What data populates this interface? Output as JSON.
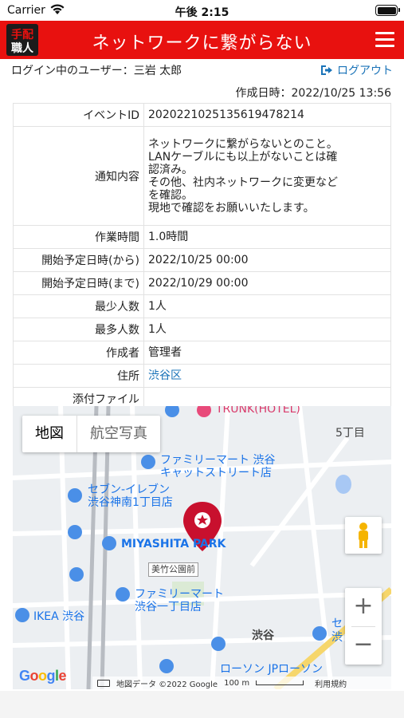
{
  "status_bar": {
    "carrier": "Carrier",
    "time": "午後 2:15"
  },
  "header": {
    "title": "ネットワークに繋がらない",
    "logo": "手配職人"
  },
  "user": {
    "label": "ログイン中のユーザー：三岩 太郎",
    "logout": "ログアウト"
  },
  "created": "作成日時：2022/10/25 13:56",
  "details": {
    "event_id": {
      "label": "イベントID",
      "value": "202022102513561947821 4"
    },
    "notice": {
      "label": "通知内容",
      "lines": [
        "ネットワークに繋がらないとのこと。",
        "LANケーブルにも以上がないことは確",
        "認済み。",
        "その他、社内ネットワークに変更など",
        "を確認。",
        "現地で確認をお願いいたします。"
      ]
    },
    "work_time": {
      "label": "作業時間",
      "value": "1.0時間"
    },
    "start_from": {
      "label": "開始予定日時(から)",
      "value": "2022/10/25 00:00"
    },
    "start_to": {
      "label": "開始予定日時(まで)",
      "value": "2022/10/29 00:00"
    },
    "min_people": {
      "label": "最少人数",
      "value": "1人"
    },
    "max_people": {
      "label": "最多人数",
      "value": "1人"
    },
    "author": {
      "label": "作成者",
      "value": "管理者"
    },
    "address": {
      "label": "住所",
      "value": "渋谷区"
    },
    "attachment": {
      "label": "添付ファイル",
      "value": ""
    }
  },
  "map": {
    "tabs": {
      "map": "地図",
      "satellite": "航空写真"
    },
    "labels": {
      "trunk": "TRUNK(HOTEL)",
      "block5": "5丁目",
      "familymart1_a": "ファミリーマート 渋谷",
      "familymart1_b": "キャットストリート店",
      "seven_a": "セブン-イレブン",
      "seven_b": "渋谷神南1丁目店",
      "miyashita": "MIYASHITA PARK",
      "bus": "美竹公園前",
      "familymart2_a": "ファミリーマート",
      "familymart2_b": "渋谷一丁目店",
      "ikea": "IKEA 渋谷",
      "shibuya": "渋谷",
      "lawson": "ローソン JPローソン",
      "se": "セ",
      "sa": "渋"
    },
    "google": "Google",
    "footer": {
      "data": "地図データ ©2022 Google",
      "scale": "100 m",
      "terms": "利用規約"
    }
  }
}
